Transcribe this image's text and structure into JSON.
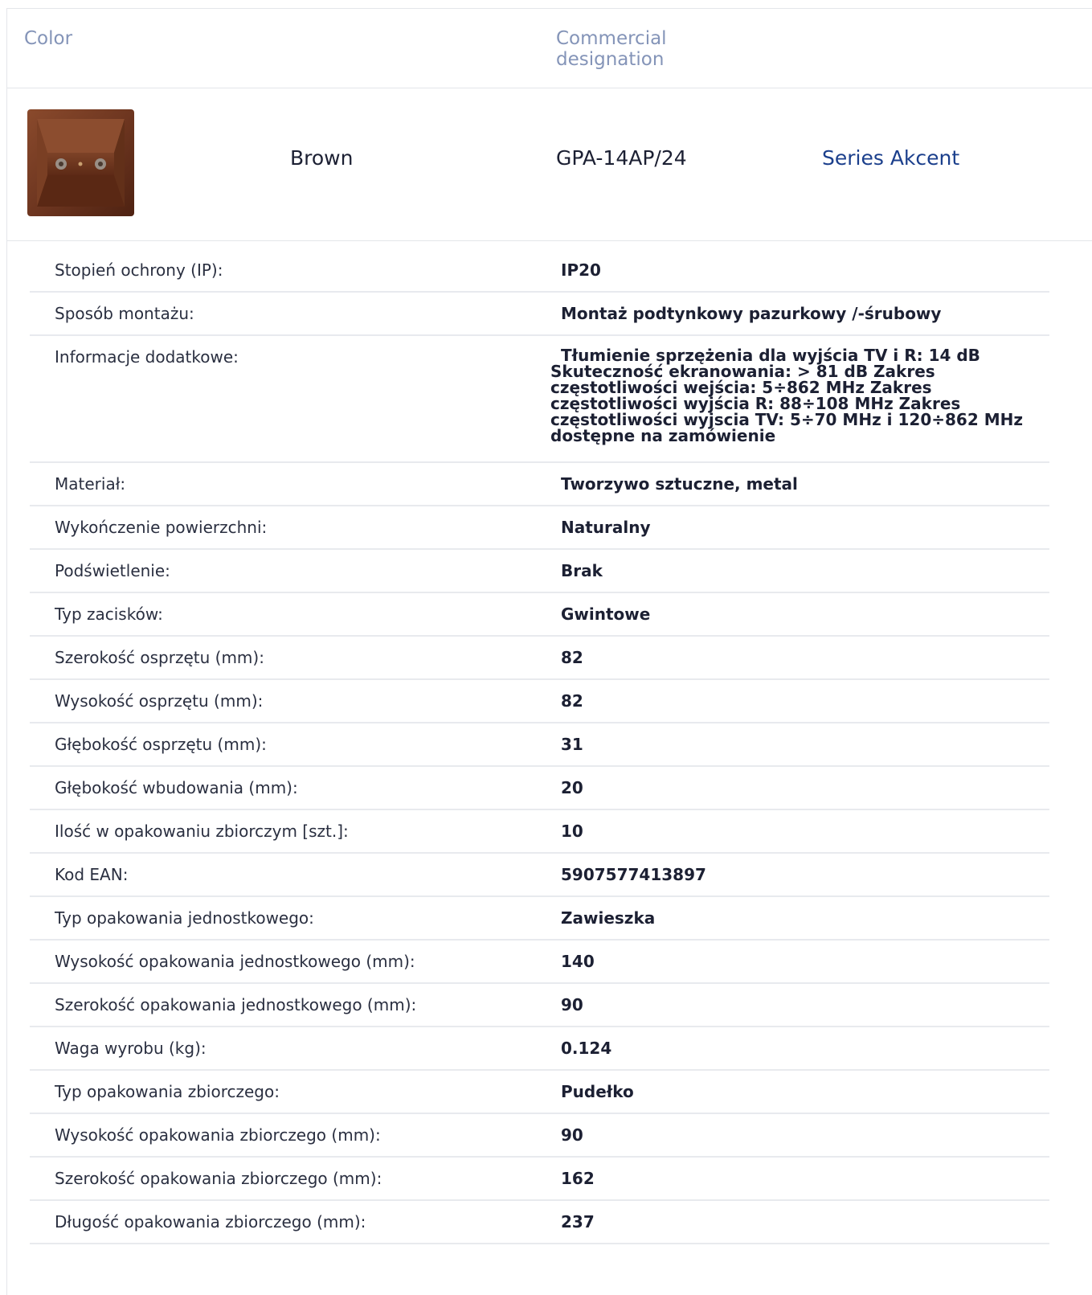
{
  "header": {
    "color_label": "Color",
    "designation_label": "Commercial designation"
  },
  "product": {
    "color": "Brown",
    "code": "GPA-14AP/24",
    "series": "Series Akcent",
    "image_icon": "brown-antenna-socket-thumbnail",
    "swatch_color": "#6e3620"
  },
  "specs": [
    {
      "label": "Stopień ochrony (IP):",
      "value": "IP20"
    },
    {
      "label": "Sposób montażu:",
      "value": "Montaż podtynkowy pazurkowy /-śrubowy"
    },
    {
      "label": "Informacje dodatkowe:",
      "value": "Tłumienie sprzężenia dla wyjścia TV i R: 14 dB Skuteczność ekranowania: > 81 dB Zakres częstotliwości wejścia: 5÷862 MHz Zakres częstotliwości wyjścia R: 88÷108 MHz Zakres częstotliwości wyjscia TV: 5÷70 MHz i 120÷862 MHz dostępne na zamówienie"
    },
    {
      "label": "Materiał:",
      "value": "Tworzywo sztuczne, metal"
    },
    {
      "label": "Wykończenie powierzchni:",
      "value": "Naturalny"
    },
    {
      "label": "Podświetlenie:",
      "value": "Brak"
    },
    {
      "label": "Typ zacisków:",
      "value": "Gwintowe"
    },
    {
      "label": "Szerokość osprzętu (mm):",
      "value": "82"
    },
    {
      "label": "Wysokość osprzętu (mm):",
      "value": "82"
    },
    {
      "label": "Głębokość osprzętu (mm):",
      "value": "31"
    },
    {
      "label": "Głębokość wbudowania (mm):",
      "value": "20"
    },
    {
      "label": "Ilość w opakowaniu zbiorczym [szt.]:",
      "value": "10"
    },
    {
      "label": "Kod EAN:",
      "value": "5907577413897"
    },
    {
      "label": "Typ opakowania jednostkowego:",
      "value": "Zawieszka"
    },
    {
      "label": "Wysokość opakowania jednostkowego (mm):",
      "value": "140"
    },
    {
      "label": "Szerokość opakowania jednostkowego (mm):",
      "value": "90"
    },
    {
      "label": "Waga wyrobu (kg):",
      "value": "0.124"
    },
    {
      "label": "Typ opakowania zbiorczego:",
      "value": "Pudełko"
    },
    {
      "label": "Wysokość opakowania zbiorczego (mm):",
      "value": "90"
    },
    {
      "label": "Szerokość opakowania zbiorczego (mm):",
      "value": "162"
    },
    {
      "label": "Długość opakowania zbiorczego (mm):",
      "value": "237"
    }
  ]
}
